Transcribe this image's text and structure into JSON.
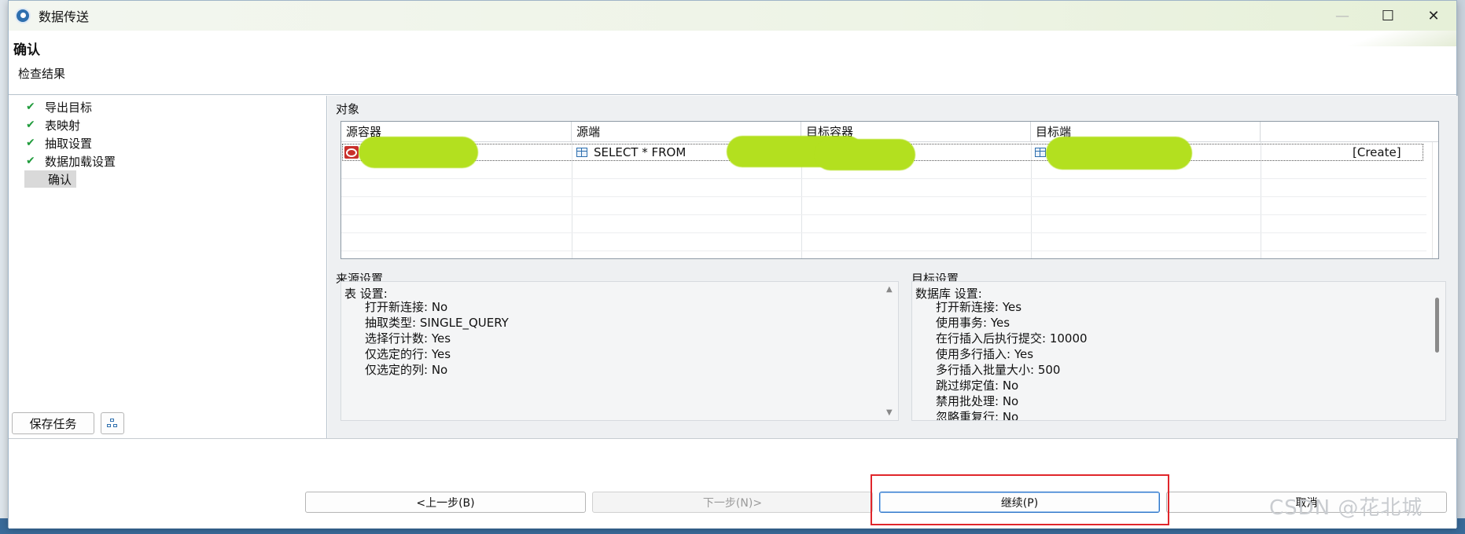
{
  "window": {
    "title": "数据传送",
    "controls": {
      "minimize": "—",
      "maximize": "☐",
      "close": "✕"
    }
  },
  "header": {
    "title": "确认",
    "subtitle": "检查结果"
  },
  "steps": [
    {
      "label": "导出目标",
      "done": true
    },
    {
      "label": "表映射",
      "done": true
    },
    {
      "label": "抽取设置",
      "done": true
    },
    {
      "label": "数据加载设置",
      "done": true
    },
    {
      "label": "确认",
      "done": false,
      "current": true
    }
  ],
  "sidebar": {
    "save_task": "保存任务"
  },
  "objects": {
    "label": "对象",
    "columns": [
      "源容器",
      "源端",
      "目标容器",
      "目标端"
    ],
    "row": {
      "source_query": "SELECT * FROM ",
      "target_suffix": "[Create]"
    }
  },
  "source_settings": {
    "label": "来源设置",
    "heading": "表 设置:",
    "lines": [
      "打开新连接: No",
      "抽取类型: SINGLE_QUERY",
      "选择行计数: Yes",
      "仅选定的行: Yes",
      "仅选定的列: No"
    ]
  },
  "target_settings": {
    "label": "目标设置",
    "heading": "数据库 设置:",
    "lines": [
      "打开新连接: Yes",
      "使用事务: Yes",
      "在行插入后执行提交: 10000",
      "使用多行插入: Yes",
      "多行插入批量大小: 500",
      "跳过绑定值: No",
      "禁用批处理: No",
      "忽略重复行: No"
    ]
  },
  "footer": {
    "prev": "<上一步(B)",
    "next": "下一步(N)>",
    "continue": "继续(P)",
    "cancel": "取消",
    "watermark": "CSDN @花北城"
  }
}
